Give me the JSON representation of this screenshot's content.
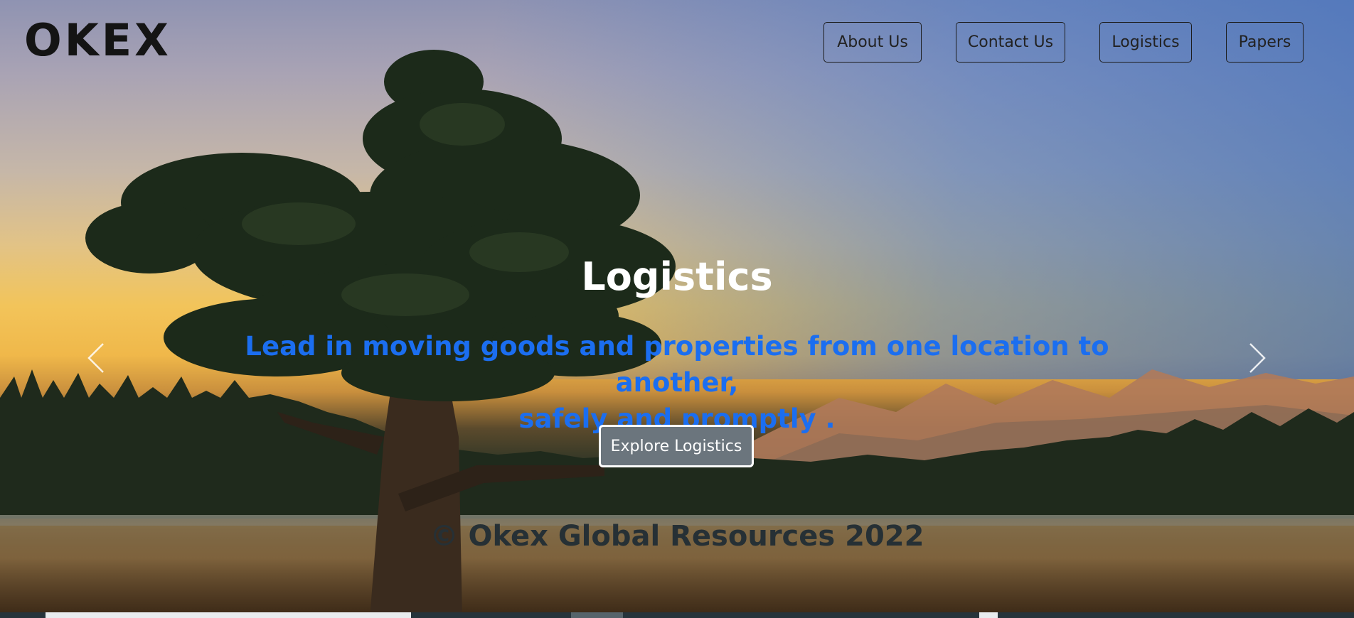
{
  "brand": {
    "logo": "OKEX"
  },
  "nav": {
    "about": "About Us",
    "contact": "Contact Us",
    "logistics": "Logistics",
    "papers": "Papers"
  },
  "hero": {
    "title": "Logistics",
    "subtitle_line1": "Lead in moving goods and properties from one location to another,",
    "subtitle_line2": "safely and promptly .",
    "cta": "Explore Logistics",
    "prev_icon": "chevron-left-icon",
    "next_icon": "chevron-right-icon"
  },
  "footer": {
    "copyright": "© Okex Global Resources 2022"
  },
  "colors": {
    "subtitle": "#1b6ef0",
    "cta_bg": "#6b757d",
    "title": "#ffffff",
    "footer_text": "#263035"
  }
}
